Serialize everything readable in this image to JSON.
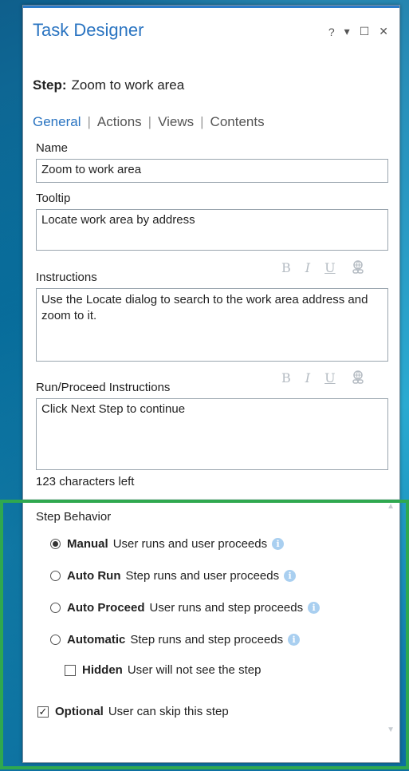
{
  "window": {
    "title": "Task Designer",
    "controls": {
      "help": "?",
      "menu": "▾",
      "maximize": "☐",
      "close": "✕"
    }
  },
  "step": {
    "label": "Step:",
    "value": "Zoom to work area"
  },
  "tabs": [
    {
      "label": "General",
      "active": true
    },
    {
      "label": "Actions",
      "active": false
    },
    {
      "label": "Views",
      "active": false
    },
    {
      "label": "Contents",
      "active": false
    }
  ],
  "name": {
    "label": "Name",
    "value": "Zoom to work area"
  },
  "tooltip": {
    "label": "Tooltip",
    "value": "Locate work area by address"
  },
  "instructions": {
    "label": "Instructions",
    "value": "Use the Locate dialog to search to the work area address and zoom to it."
  },
  "run_proceed": {
    "label": "Run/Proceed Instructions",
    "value": "Click Next Step to continue"
  },
  "format": {
    "bold": "B",
    "italic": "I",
    "underline": "U",
    "link_icon": "link-icon"
  },
  "chars_left": "123 characters left",
  "behavior": {
    "title": "Step Behavior",
    "options": [
      {
        "name": "Manual",
        "desc": "User runs and user proceeds",
        "selected": true
      },
      {
        "name": "Auto Run",
        "desc": "Step runs and user proceeds",
        "selected": false
      },
      {
        "name": "Auto Proceed",
        "desc": "User runs and step proceeds",
        "selected": false
      },
      {
        "name": "Automatic",
        "desc": "Step runs and step proceeds",
        "selected": false
      }
    ],
    "hidden": {
      "name": "Hidden",
      "desc": "User will not see the step",
      "checked": false
    },
    "optional": {
      "name": "Optional",
      "desc": "User can skip this step",
      "checked": true
    }
  },
  "colors": {
    "accent": "#2a74c1",
    "highlight": "#2fa84f",
    "info": "#a9cff0"
  }
}
